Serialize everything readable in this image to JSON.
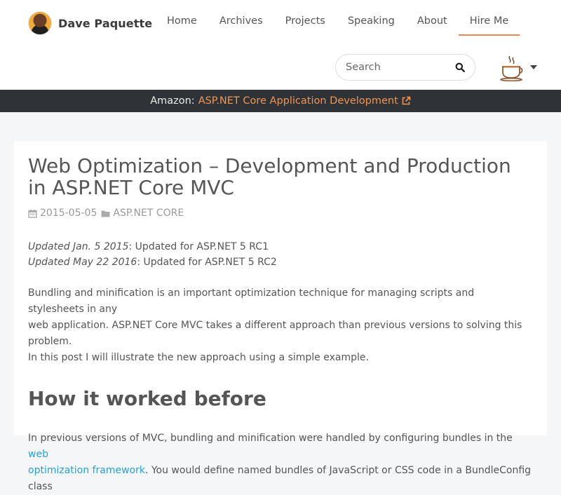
{
  "header": {
    "brand_name": "Dave Paquette",
    "nav": [
      {
        "label": "Home"
      },
      {
        "label": "Archives"
      },
      {
        "label": "Projects"
      },
      {
        "label": "Speaking"
      },
      {
        "label": "About"
      },
      {
        "label": "Hire Me",
        "active": true
      }
    ],
    "search_placeholder": "Search",
    "icons": {
      "search": "search-icon",
      "theme": "coffee-cup-icon",
      "dropdown": "caret-down-icon"
    }
  },
  "promo": {
    "prefix": "Amazon:",
    "link_text": "ASP.NET Core Application Development",
    "icon": "external-link-icon"
  },
  "post": {
    "title": "Web Optimization – Development and Production in ASP.NET Core MVC",
    "date": "2015-05-05",
    "category": "ASP.NET CORE",
    "updates": [
      {
        "when": "Updated Jan. 5 2015",
        "text": ": Updated for ASP.NET 5 RC1"
      },
      {
        "when": "Updated May 22 2016",
        "text": ": Updated for ASP.NET 5 RC2"
      }
    ],
    "intro_line1": "Bundling and minification is an important optimization technique for managing scripts and stylesheets in any",
    "intro_line2": "web application. ASP.NET Core MVC takes a different approach than previous versions to solving this problem.",
    "intro_line3": "In this post I will illustrate the new approach using a simple example.",
    "section_heading": "How it worked before",
    "section_text_before_link": "In previous versions of MVC, bundling and minification were handled by configuring bundles in the ",
    "section_link_line1": "web",
    "section_link_line2": "optimization framework",
    "section_text_after_link": ". You would define named bundles of JavaScript or CSS code in a BundleConfig class"
  }
}
